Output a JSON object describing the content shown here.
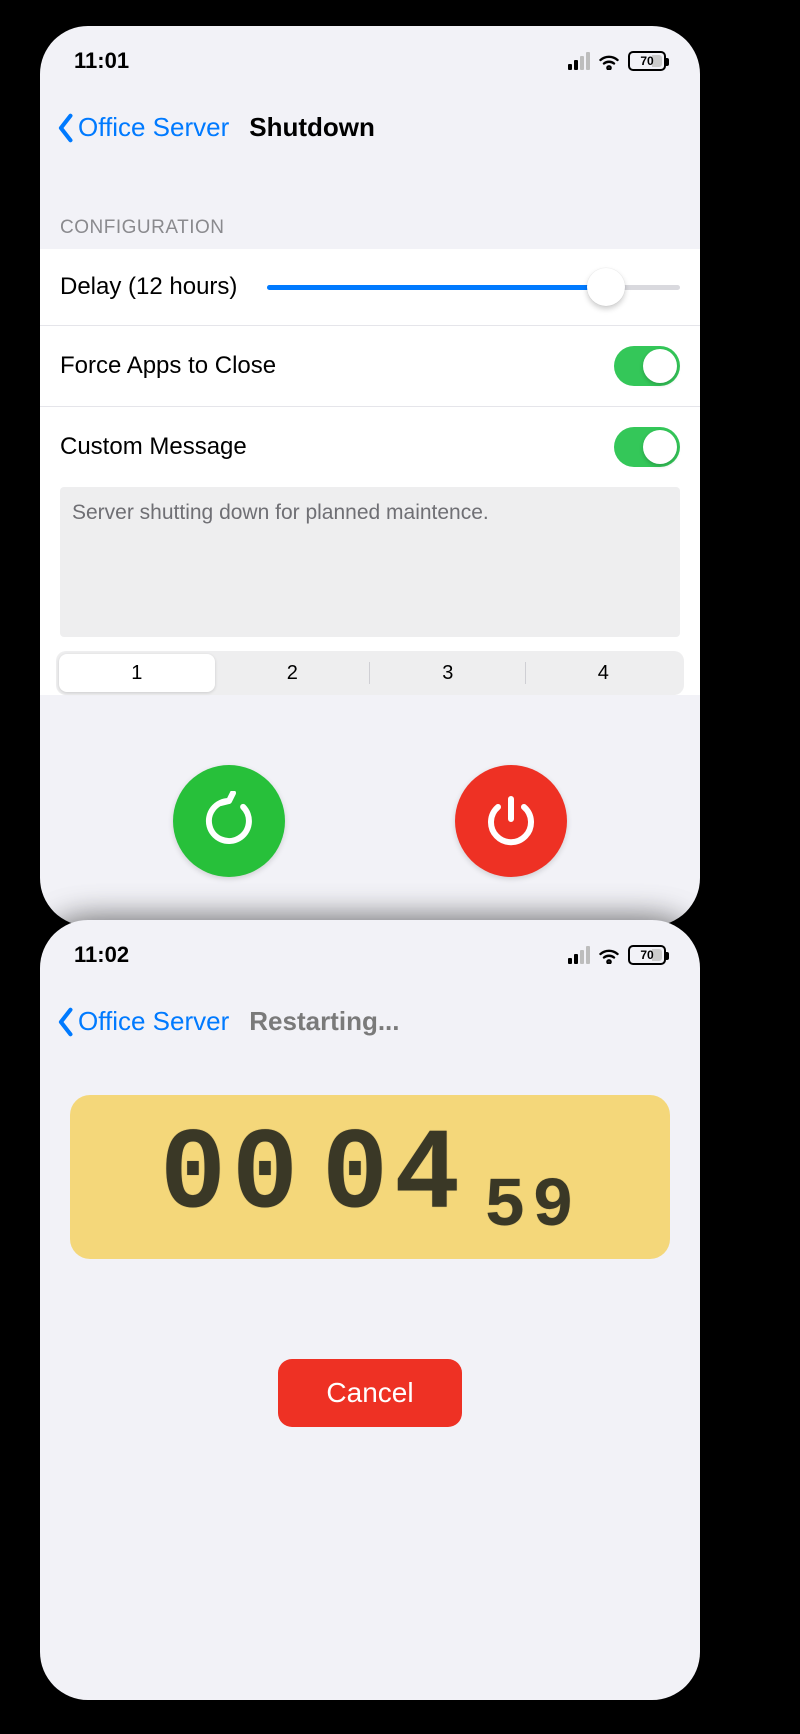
{
  "screen1": {
    "status": {
      "time": "11:01",
      "battery": "70"
    },
    "nav": {
      "back": "Office Server",
      "title": "Shutdown"
    },
    "section_header": "CONFIGURATION",
    "delay": {
      "label": "Delay (12 hours)",
      "pct": 82
    },
    "force_close": {
      "label": "Force Apps to Close",
      "on": true
    },
    "custom_msg": {
      "label": "Custom Message",
      "on": true
    },
    "message_text": "Server shutting down for planned maintence.",
    "segments": [
      "1",
      "2",
      "3",
      "4"
    ],
    "selected_segment": 0
  },
  "screen2": {
    "status": {
      "time": "11:02",
      "battery": "70"
    },
    "nav": {
      "back": "Office Server",
      "title": "Restarting..."
    },
    "timer": {
      "hh": "00",
      "mm": "04",
      "ss": "59"
    },
    "cancel": "Cancel"
  },
  "colors": {
    "tint": "#007aff",
    "green": "#27c03a",
    "red": "#ee3124",
    "switch_on": "#34c759",
    "timer_bg": "#f4d77a"
  }
}
